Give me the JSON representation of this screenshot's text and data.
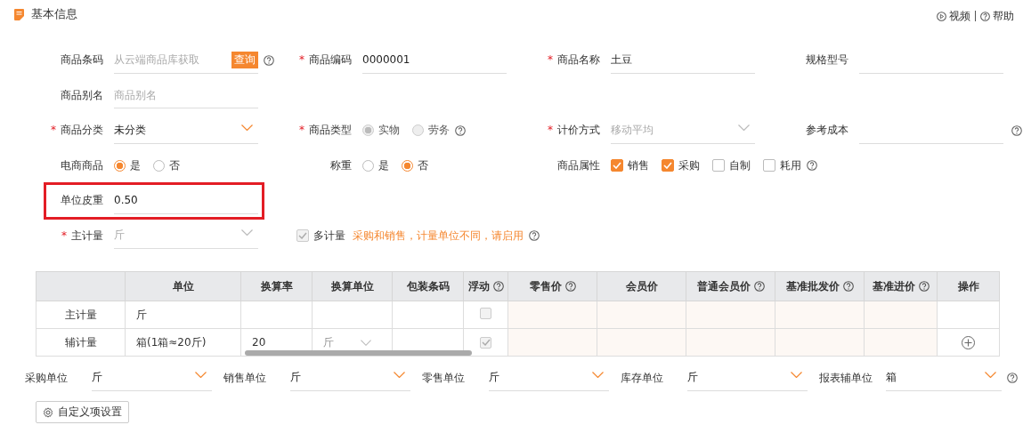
{
  "header": {
    "title": "基本信息",
    "links": [
      {
        "kind": "video",
        "label": "视频"
      },
      {
        "kind": "help",
        "label": "帮助"
      }
    ]
  },
  "form_rows": [
    [
      {
        "kind": "input",
        "label": "商品条码",
        "placeholder": "从云端商品库获取",
        "button": "查询",
        "help": true
      },
      {
        "kind": "input",
        "mark": "*",
        "label": "商品编码",
        "value": "0000001"
      },
      {
        "kind": "input",
        "mark": "*",
        "label": "商品名称",
        "value": "土豆"
      },
      {
        "kind": "input",
        "label": "规格型号"
      }
    ],
    [
      {
        "kind": "input",
        "label": "商品别名",
        "placeholder": "商品别名"
      }
    ],
    [
      {
        "kind": "select",
        "mark": "*",
        "label": "商品分类",
        "value": "未分类",
        "disabled": false
      },
      {
        "kind": "radio",
        "mark": "*",
        "label": "商品类型",
        "disabled": true,
        "help": true,
        "options": [
          {
            "label": "实物",
            "selected": true
          },
          {
            "label": "劳务",
            "selected": false
          }
        ]
      },
      {
        "kind": "select",
        "mark": "*",
        "label": "计价方式",
        "value": "移动平均",
        "disabled": true
      },
      {
        "kind": "input",
        "label": "参考成本",
        "help": true
      }
    ],
    [
      {
        "kind": "radio",
        "label": "电商商品",
        "disabled": false,
        "options": [
          {
            "label": "是",
            "selected": true
          },
          {
            "label": "否",
            "selected": false
          }
        ]
      },
      {
        "kind": "radio",
        "label": "称重",
        "disabled": false,
        "options": [
          {
            "label": "是",
            "selected": false
          },
          {
            "label": "否",
            "selected": true
          }
        ]
      },
      {
        "kind": "checks",
        "label": "商品属性",
        "help": true,
        "options": [
          {
            "label": "销售",
            "checked": true
          },
          {
            "label": "采购",
            "checked": true
          },
          {
            "label": "自制",
            "checked": false
          },
          {
            "label": "耗用",
            "checked": false
          }
        ]
      }
    ],
    [
      {
        "kind": "input",
        "label": "单位皮重",
        "value": "0.50",
        "highlighted": true
      }
    ],
    [
      {
        "kind": "select",
        "mark": "*",
        "label": "主计量",
        "value": "斤",
        "disabled": true
      },
      {
        "kind": "switch",
        "label": "多计量",
        "checked": true,
        "disabled": true,
        "note": "采购和销售，计量单位不同，请启用",
        "help": true
      }
    ]
  ],
  "unit_table": {
    "columns": [
      {},
      {
        "label": "单位"
      },
      {
        "label": "换算率"
      },
      {
        "label": "换算单位"
      },
      {
        "label": "包装条码"
      },
      {
        "label": "浮动",
        "help": true
      },
      {
        "label": "零售价",
        "help": true,
        "price": true
      },
      {
        "label": "会员价",
        "price": true
      },
      {
        "label": "普通会员价",
        "help": true,
        "price": true
      },
      {
        "label": "基准批发价",
        "help": true,
        "price": true
      },
      {
        "label": "基准进价",
        "help": true,
        "price": true
      },
      {
        "label": "操作"
      }
    ],
    "rows": [
      {
        "label": "主计量",
        "unit": "斤",
        "float": false,
        "add": false
      },
      {
        "label": "辅计量",
        "unit": "箱(1箱≈20斤)",
        "rate": "20",
        "conv_unit": "斤",
        "float": true,
        "add": true
      }
    ]
  },
  "unit_selects": [
    {
      "label": "采购单位",
      "value": "斤"
    },
    {
      "label": "销售单位",
      "value": "斤"
    },
    {
      "label": "零售单位",
      "value": "斤"
    },
    {
      "label": "库存单位",
      "value": "斤"
    },
    {
      "label": "报表辅单位",
      "value": "箱",
      "help": true
    }
  ],
  "custom_button": "自定义项设置"
}
